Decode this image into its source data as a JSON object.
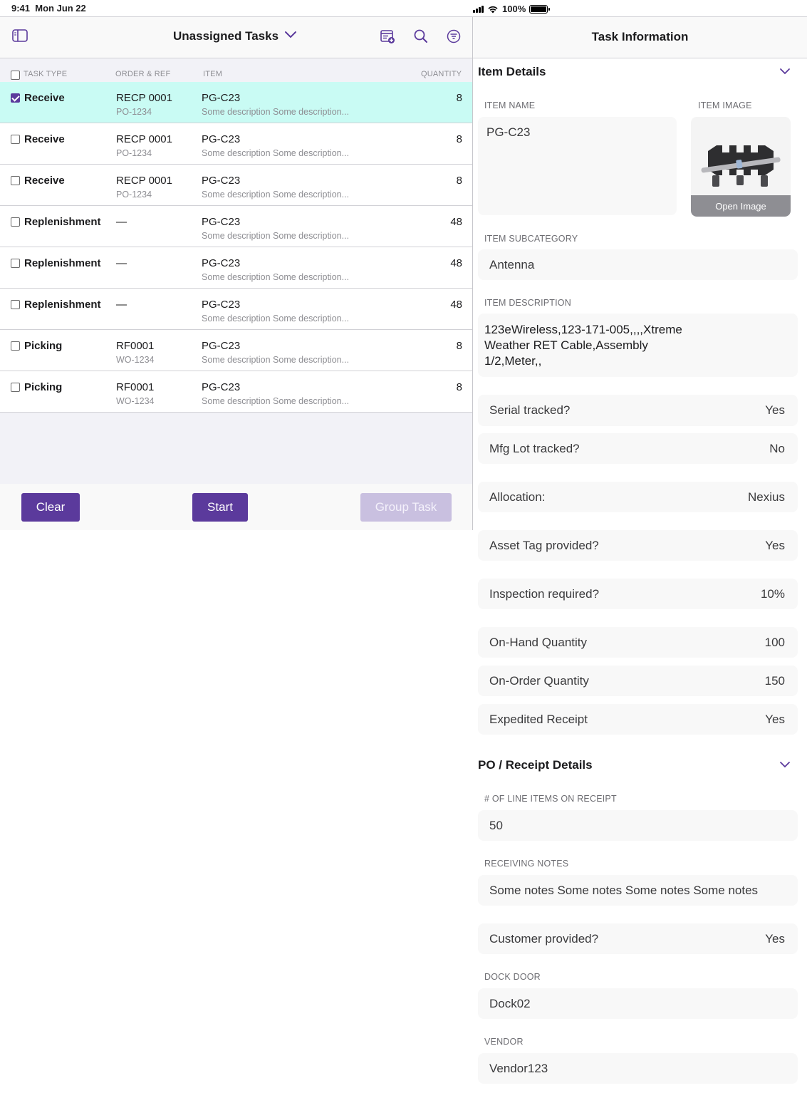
{
  "status": {
    "time": "9:41",
    "date": "Mon Jun 22",
    "battery": "100%"
  },
  "left": {
    "title": "Unassigned Tasks",
    "columns": {
      "task_type": "TASK TYPE",
      "order_ref": "ORDER & REF",
      "item": "ITEM",
      "quantity": "QUANTITY"
    },
    "rows": [
      {
        "type": "Receive",
        "order": "RECP 0001",
        "ref": "PO-1234",
        "item": "PG-C23",
        "desc": "Some description Some description...",
        "qty": "8",
        "checked": true
      },
      {
        "type": "Receive",
        "order": "RECP 0001",
        "ref": "PO-1234",
        "item": "PG-C23",
        "desc": "Some description Some description...",
        "qty": "8",
        "checked": false
      },
      {
        "type": "Receive",
        "order": "RECP 0001",
        "ref": "PO-1234",
        "item": "PG-C23",
        "desc": "Some description Some description...",
        "qty": "8",
        "checked": false
      },
      {
        "type": "Replenishment",
        "order": "—",
        "ref": "",
        "item": "PG-C23",
        "desc": "Some description Some description...",
        "qty": "48",
        "checked": false
      },
      {
        "type": "Replenishment",
        "order": "—",
        "ref": "",
        "item": "PG-C23",
        "desc": "Some description Some description...",
        "qty": "48",
        "checked": false
      },
      {
        "type": "Replenishment",
        "order": "—",
        "ref": "",
        "item": "PG-C23",
        "desc": "Some description Some description...",
        "qty": "48",
        "checked": false
      },
      {
        "type": "Picking",
        "order": "RF0001",
        "ref": "WO-1234",
        "item": "PG-C23",
        "desc": "Some description Some description...",
        "qty": "8",
        "checked": false
      },
      {
        "type": "Picking",
        "order": "RF0001",
        "ref": "WO-1234",
        "item": "PG-C23",
        "desc": "Some description Some description...",
        "qty": "8",
        "checked": false
      }
    ],
    "buttons": {
      "clear": "Clear",
      "start": "Start",
      "group": "Group Task"
    }
  },
  "right": {
    "title": "Task Information",
    "item_details": {
      "section_title": "Item Details",
      "item_name_label": "ITEM NAME",
      "item_name": "PG-C23",
      "item_image_label": "ITEM IMAGE",
      "open_image": "Open Image",
      "subcategory_label": "ITEM SUBCATEGORY",
      "subcategory": "Antenna",
      "description_label": "ITEM DESCRIPTION",
      "description": "123eWireless,123-171-005,,,,Xtreme Weather RET Cable,Assembly 1/2,Meter,,",
      "serial_label": "Serial tracked?",
      "serial": "Yes",
      "mfg_label": "Mfg Lot tracked?",
      "mfg": "No",
      "allocation_label": "Allocation:",
      "allocation": "Nexius",
      "asset_label": "Asset Tag provided?",
      "asset": "Yes",
      "inspection_label": "Inspection required?",
      "inspection": "10%",
      "onhand_label": "On-Hand Quantity",
      "onhand": "100",
      "onorder_label": "On-Order Quantity",
      "onorder": "150",
      "expedited_label": "Expedited Receipt",
      "expedited": "Yes"
    },
    "po_details": {
      "section_title": "PO / Receipt Details",
      "line_items_label": "# OF LINE ITEMS ON RECEIPT",
      "line_items": "50",
      "notes_label": "RECEIVING NOTES",
      "notes": "Some notes Some notes Some notes Some notes",
      "customer_label": "Customer provided?",
      "customer": "Yes",
      "dock_label": "DOCK DOOR",
      "dock": "Dock02",
      "vendor_label": "VENDOR",
      "vendor": "Vendor123"
    }
  },
  "colors": {
    "accent": "#5b3a9c",
    "selected_row": "#c9fbf4",
    "disabled_button": "#c9c0e0"
  }
}
